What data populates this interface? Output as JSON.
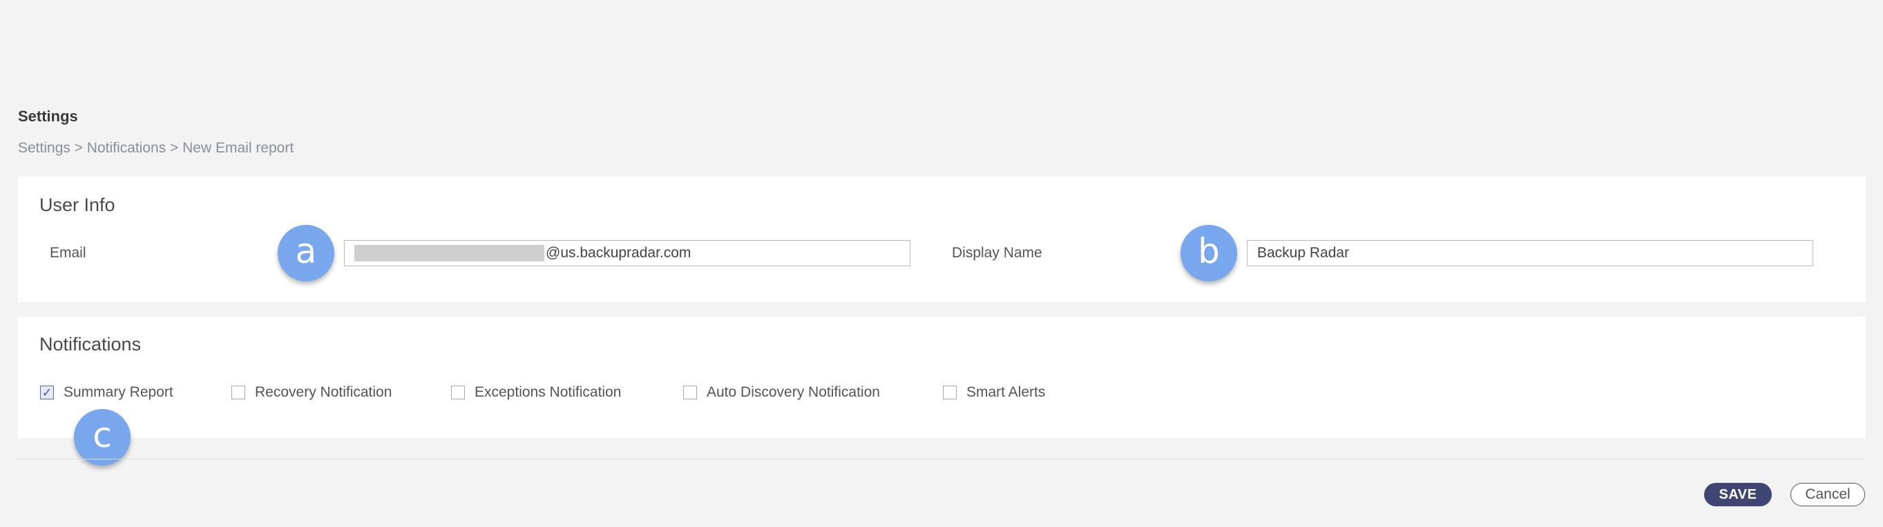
{
  "header": {
    "title": "Settings",
    "breadcrumb": "Settings > Notifications > New Email report"
  },
  "user_info": {
    "title": "User Info",
    "email_label": "Email",
    "email_value": "@us.backupradar.com",
    "display_name_label": "Display Name",
    "display_name_value": "Backup Radar"
  },
  "notifications": {
    "title": "Notifications",
    "options": [
      {
        "label": "Summary Report",
        "checked": true
      },
      {
        "label": "Recovery Notification",
        "checked": false
      },
      {
        "label": "Exceptions Notification",
        "checked": false
      },
      {
        "label": "Auto Discovery Notification",
        "checked": false
      },
      {
        "label": "Smart Alerts",
        "checked": false
      }
    ]
  },
  "annotations": {
    "a": "a",
    "b": "b",
    "c": "c"
  },
  "actions": {
    "save_label": "SAVE",
    "cancel_label": "Cancel"
  },
  "colors": {
    "background": "#f3f3f4",
    "card": "#ffffff",
    "badge": "#78a7ee",
    "save_button": "#3f4673"
  }
}
